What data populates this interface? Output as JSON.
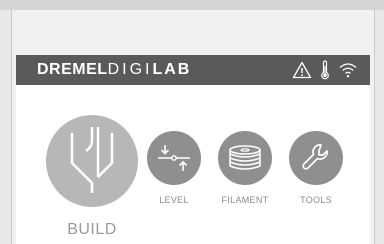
{
  "header": {
    "logo_brand": "DREMEL",
    "logo_digi": "DIGI",
    "logo_lab": "LAB",
    "icons": [
      "warning-icon",
      "thermometer-icon",
      "wifi-icon"
    ]
  },
  "menu": {
    "build_label": "BUILD",
    "level_label": "LEVEL",
    "filament_label": "FILAMENT",
    "tools_label": "TOOLS"
  },
  "colors": {
    "header_bg": "#5a5a5a",
    "build_circle": "#b7b7b7",
    "small_circle": "#8f8f8f",
    "label_text": "#8a8a8a"
  }
}
